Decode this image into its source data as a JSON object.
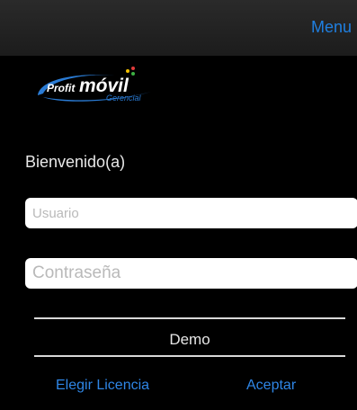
{
  "header": {
    "menu_label": "Menu"
  },
  "logo": {
    "brand_primary": "Profit",
    "brand_secondary": "móvil",
    "brand_tag": "Gerencial"
  },
  "welcome": "Bienvenido(a)",
  "form": {
    "user_placeholder": "Usuario",
    "password_placeholder": "Contraseña"
  },
  "license_selected": "Demo",
  "footer": {
    "choose_license_label": "Elegir Licencia",
    "accept_label": "Aceptar"
  },
  "colors": {
    "accent": "#1f7fe0",
    "background": "#000000",
    "topbar": "#222222"
  }
}
